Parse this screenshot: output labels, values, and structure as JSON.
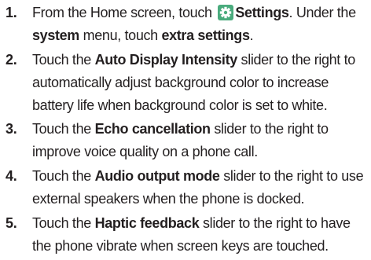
{
  "icons": {
    "settings": "gear-icon",
    "settings_color": "#4aab7d"
  },
  "steps": [
    {
      "number": "1.",
      "p1": "From the Home screen, touch ",
      "b1": "Settings",
      "p2": ". Under the",
      "b2": "system",
      "p3": " menu, touch ",
      "b3": "extra settings",
      "p4": "."
    },
    {
      "number": "2.",
      "p1": "Touch the ",
      "b1": "Auto Display Intensity",
      "p2": " slider to the right to",
      "l2": "automatically adjust background color to increase",
      "l3": "battery life when background color is set to white."
    },
    {
      "number": "3.",
      "p1": "Touch the ",
      "b1": "Echo cancellation",
      "p2": " slider to the right to",
      "l2": "improve voice quality on a phone call."
    },
    {
      "number": "4.",
      "p1": "Touch the ",
      "b1": "Audio output mode",
      "p2": " slider to the right to use",
      "l2": "external speakers when the phone is docked."
    },
    {
      "number": "5.",
      "p1": "Touch the ",
      "b1": "Haptic feedback",
      "p2": " slider to the right to have",
      "l2": "the phone vibrate when screen keys are touched."
    }
  ]
}
